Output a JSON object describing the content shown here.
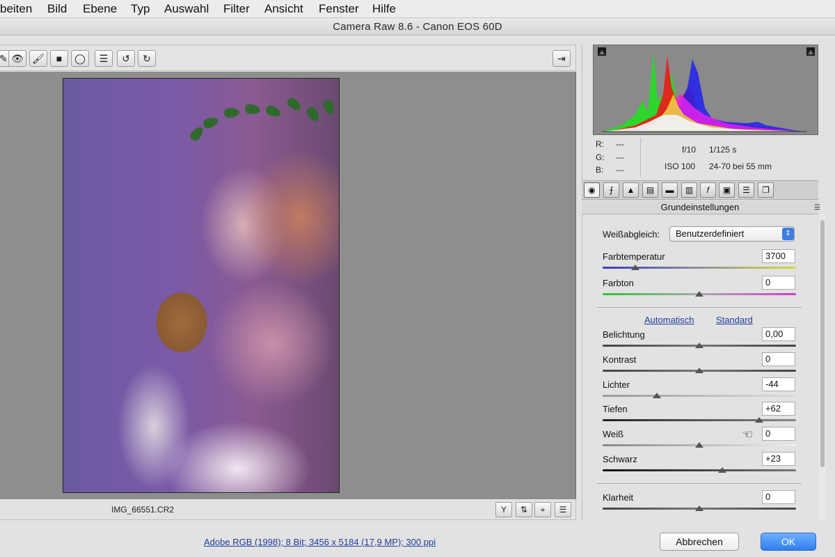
{
  "menu": [
    "beiten",
    "Bild",
    "Ebene",
    "Typ",
    "Auswahl",
    "Filter",
    "Ansicht",
    "Fenster",
    "Hilfe"
  ],
  "dialog_title": "Camera Raw 8.6 - Canon EOS 60D",
  "toolbar_icons": [
    "zoom-icon",
    "red-eye-icon",
    "adjustment-brush-icon",
    "graduated-filter-icon",
    "radial-filter-icon",
    "preferences-icon",
    "rotate-left-icon",
    "rotate-right-icon"
  ],
  "preview": {
    "filename": "IMG_66551.CR2"
  },
  "histogram": {
    "shadow_clip_icon": "shadow-clipping-warning-icon",
    "highlight_clip_icon": "highlight-clipping-warning-icon"
  },
  "info": {
    "r_label": "R:",
    "r_val": "---",
    "g_label": "G:",
    "g_val": "---",
    "b_label": "B:",
    "b_val": "---",
    "aperture": "f/10",
    "shutter": "1/125 s",
    "iso": "ISO 100",
    "lens": "24-70 bei 55 mm"
  },
  "panel": {
    "section_title": "Grundeinstellungen",
    "wb_label": "Weißabgleich:",
    "wb_value": "Benutzerdefiniert",
    "auto_link": "Automatisch",
    "default_link": "Standard",
    "sliders": [
      {
        "label": "Farbtemperatur",
        "value": "3700",
        "fraction": 0.17
      },
      {
        "label": "Farbton",
        "value": "0",
        "fraction": 0.5
      },
      {
        "label": "Belichtung",
        "value": "0,00",
        "fraction": 0.5
      },
      {
        "label": "Kontrast",
        "value": "0",
        "fraction": 0.5
      },
      {
        "label": "Lichter",
        "value": "-44",
        "fraction": 0.28
      },
      {
        "label": "Tiefen",
        "value": "+62",
        "fraction": 0.81
      },
      {
        "label": "Weiß",
        "value": "0",
        "fraction": 0.5
      },
      {
        "label": "Schwarz",
        "value": "+23",
        "fraction": 0.62
      },
      {
        "label": "Klarheit",
        "value": "0",
        "fraction": 0.5
      }
    ]
  },
  "bottom": {
    "info_link": "Adobe RGB (1998); 8 Bit; 3456 x 5184 (17,9 MP); 300 ppi",
    "cancel": "Abbrechen",
    "ok": "OK"
  },
  "colors": {
    "ok_blue": "#2f7ff0",
    "link_blue": "#1f3c9c",
    "temp_track_start": "#3a3ab8",
    "temp_track_end": "#d8d840",
    "tint_track_start": "#2ec23a",
    "tint_track_end": "#d23ad2"
  }
}
